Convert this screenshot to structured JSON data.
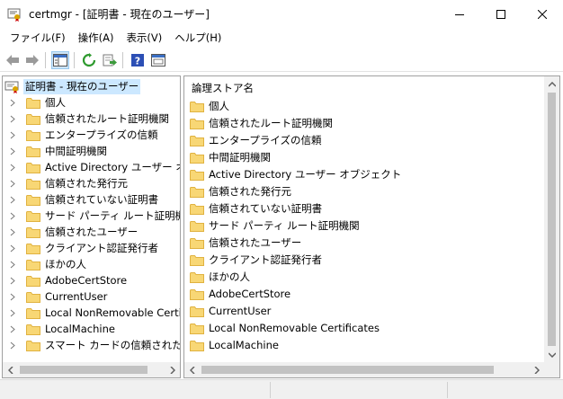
{
  "window": {
    "title": "certmgr - [証明書 - 現在のユーザー]"
  },
  "menu": {
    "items": [
      "ファイル(F)",
      "操作(A)",
      "表示(V)",
      "ヘルプ(H)"
    ]
  },
  "toolbar": {
    "buttons": [
      "back-arrow-icon",
      "forward-arrow-icon",
      "show-hide-tree-icon",
      "refresh-icon",
      "export-list-icon",
      "help-icon",
      "properties-icon"
    ]
  },
  "tree": {
    "root_label": "証明書 - 現在のユーザー",
    "items": [
      "個人",
      "信頼されたルート証明機関",
      "エンタープライズの信頼",
      "中間証明機関",
      "Active Directory ユーザー オブジェ",
      "信頼された発行元",
      "信頼されていない証明書",
      "サード パーティ ルート証明機関",
      "信頼されたユーザー",
      "クライアント認証発行者",
      "ほかの人",
      "AdobeCertStore",
      "CurrentUser",
      "Local NonRemovable Certifica",
      "LocalMachine",
      "スマート カードの信頼されたルート"
    ]
  },
  "list": {
    "column_header": "論理ストア名",
    "items": [
      "個人",
      "信頼されたルート証明機関",
      "エンタープライズの信頼",
      "中間証明機関",
      "Active Directory ユーザー オブジェクト",
      "信頼された発行元",
      "信頼されていない証明書",
      "サード パーティ ルート証明機関",
      "信頼されたユーザー",
      "クライアント認証発行者",
      "ほかの人",
      "AdobeCertStore",
      "CurrentUser",
      "Local NonRemovable Certificates",
      "LocalMachine"
    ]
  },
  "colors": {
    "selection": "#cce8ff",
    "folder": "#f8d775",
    "folder_dark": "#e0b240"
  }
}
